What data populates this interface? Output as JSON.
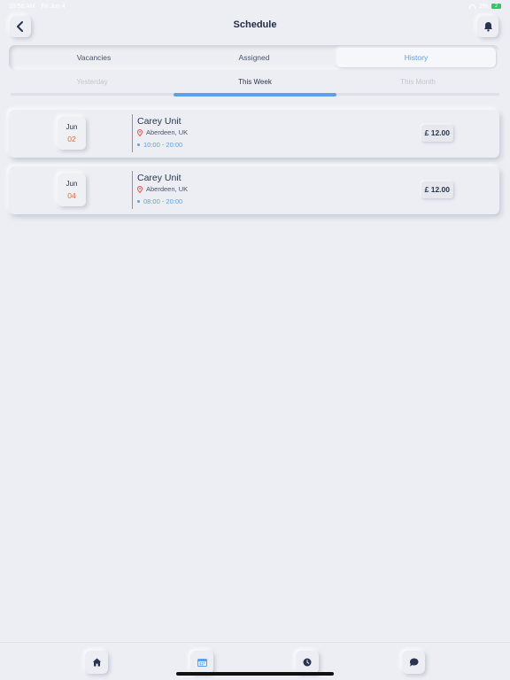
{
  "status_bar": {
    "time": "10:58 AM",
    "date": "Fri Jun 4",
    "battery_percent": "2%",
    "battery_level": "2"
  },
  "header": {
    "title": "Schedule",
    "back_icon": "chevron-left-icon",
    "notification_icon": "bell-icon"
  },
  "segmented_tabs": {
    "items": [
      {
        "label": "Vacancies"
      },
      {
        "label": "Assigned"
      },
      {
        "label": "History"
      }
    ],
    "selected": "History"
  },
  "period_tabs": {
    "items": [
      {
        "label": "Yesterday"
      },
      {
        "label": "This Week"
      },
      {
        "label": "This Month"
      }
    ],
    "selected": "This Week"
  },
  "shifts": [
    {
      "month": "Jun",
      "day": "02",
      "unit": "Carey Unit",
      "location": "Aberdeen, UK",
      "time": "10:00 - 20:00",
      "price": "£ 12.00"
    },
    {
      "month": "Jun",
      "day": "04",
      "unit": "Carey Unit",
      "location": "Aberdeen, UK",
      "time": "08:00 - 20:00",
      "price": "£ 12.00"
    }
  ],
  "tab_bar": {
    "items": [
      {
        "name": "home",
        "icon": "home-icon"
      },
      {
        "name": "schedule",
        "icon": "calendar-icon",
        "active": true
      },
      {
        "name": "timesheet",
        "icon": "clock-icon"
      },
      {
        "name": "messages",
        "icon": "chat-icon"
      }
    ]
  },
  "colors": {
    "accent": "#5aa0f0",
    "date_day": "#e8673c",
    "background": "#eceef3",
    "text": "#2a3450"
  }
}
